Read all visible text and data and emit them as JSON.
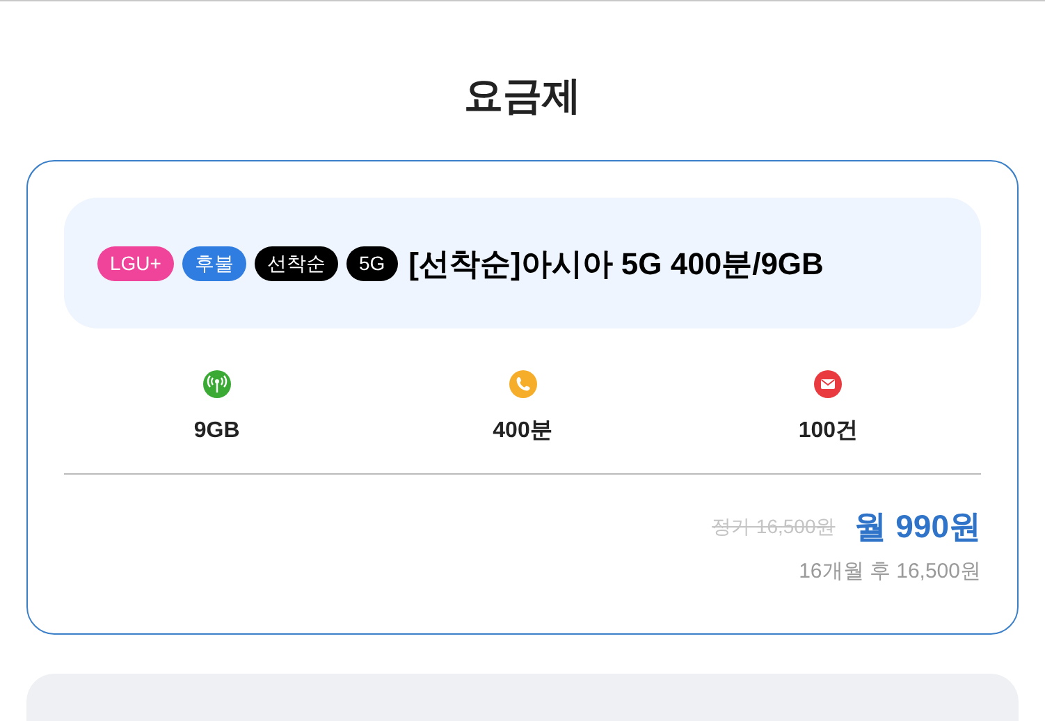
{
  "page_title": "요금제",
  "plan": {
    "tags": [
      {
        "label": "LGU+",
        "color": "#f0449a"
      },
      {
        "label": "후불",
        "color": "#2f7de1"
      },
      {
        "label": "선착순",
        "color": "#000000"
      },
      {
        "label": "5G",
        "color": "#000000"
      }
    ],
    "name": "[선착순]아시아 5G 400분/9GB",
    "specs": [
      {
        "kind": "data",
        "value": "9GB"
      },
      {
        "kind": "voice",
        "value": "400분"
      },
      {
        "kind": "sms",
        "value": "100건"
      }
    ],
    "original_price": "정가 16,500원",
    "price": "월 990원",
    "after_price": "16개월 후 16,500원"
  }
}
